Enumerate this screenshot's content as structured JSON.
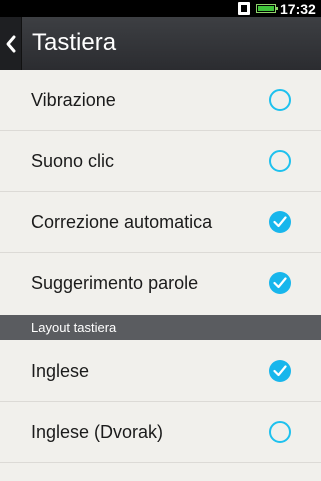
{
  "status_bar": {
    "time": "17:32",
    "sim_icon": "sim-card-icon",
    "battery_icon": "battery-icon"
  },
  "app_bar": {
    "title": "Tastiera",
    "back_icon": "chevron-left-icon"
  },
  "settings": [
    {
      "label": "Vibrazione",
      "checked": false
    },
    {
      "label": "Suono clic",
      "checked": false
    },
    {
      "label": "Correzione automatica",
      "checked": true
    },
    {
      "label": "Suggerimento parole",
      "checked": true
    }
  ],
  "section_header": "Layout tastiera",
  "layouts": [
    {
      "label": "Inglese",
      "checked": true
    },
    {
      "label": "Inglese (Dvorak)",
      "checked": false
    }
  ],
  "colors": {
    "accent": "#18b6ec",
    "background": "#f1f0ec",
    "header": "#5a5c60"
  }
}
